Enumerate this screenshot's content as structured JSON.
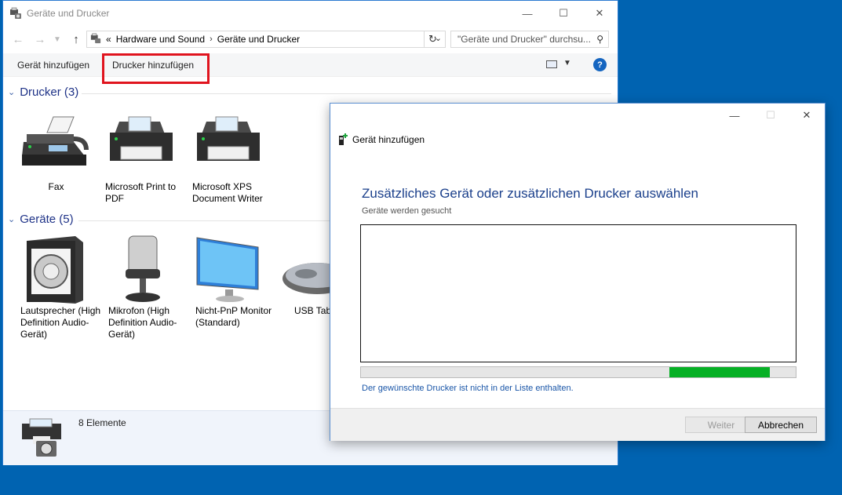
{
  "explorer": {
    "title": "Geräte und Drucker",
    "breadcrumb": {
      "overflow": "«",
      "items": [
        "Hardware und Sound",
        "Geräte und Drucker"
      ]
    },
    "search_placeholder": "\"Geräte und Drucker\" durchsu...",
    "commands": {
      "add_device": "Gerät hinzufügen",
      "add_printer": "Drucker hinzufügen"
    },
    "groups": {
      "printers": {
        "label": "Drucker (3)"
      },
      "devices": {
        "label": "Geräte (5)"
      }
    },
    "printers": [
      {
        "label": "Fax",
        "icon": "fax-icon"
      },
      {
        "label": "Microsoft Print to PDF",
        "icon": "printer-icon"
      },
      {
        "label": "Microsoft XPS Document Writer",
        "icon": "printer-icon"
      }
    ],
    "devices": [
      {
        "label": "Lautsprecher (High Definition Audio-Gerät)",
        "icon": "speaker-icon"
      },
      {
        "label": "Mikrofon (High Definition Audio-Gerät)",
        "icon": "microphone-icon"
      },
      {
        "label": "Nicht-PnP Monitor (Standard)",
        "icon": "monitor-icon"
      },
      {
        "label": "USB Table",
        "icon": "mouse-icon"
      }
    ],
    "status": {
      "count": "8 Elemente"
    }
  },
  "dialog": {
    "title": "Gerät hinzufügen",
    "heading": "Zusätzliches Gerät oder zusätzlichen Drucker auswählen",
    "subheading": "Geräte werden gesucht",
    "progress": {
      "start": 0.71,
      "end": 0.94
    },
    "link": "Der gewünschte Drucker ist nicht in der Liste enthalten.",
    "buttons": {
      "next": "Weiter",
      "cancel": "Abbrechen"
    }
  },
  "colors": {
    "desktop": "#0063b1",
    "accent_text": "#1a3f8b",
    "progress": "#06b025",
    "highlight": "#e0141e"
  }
}
